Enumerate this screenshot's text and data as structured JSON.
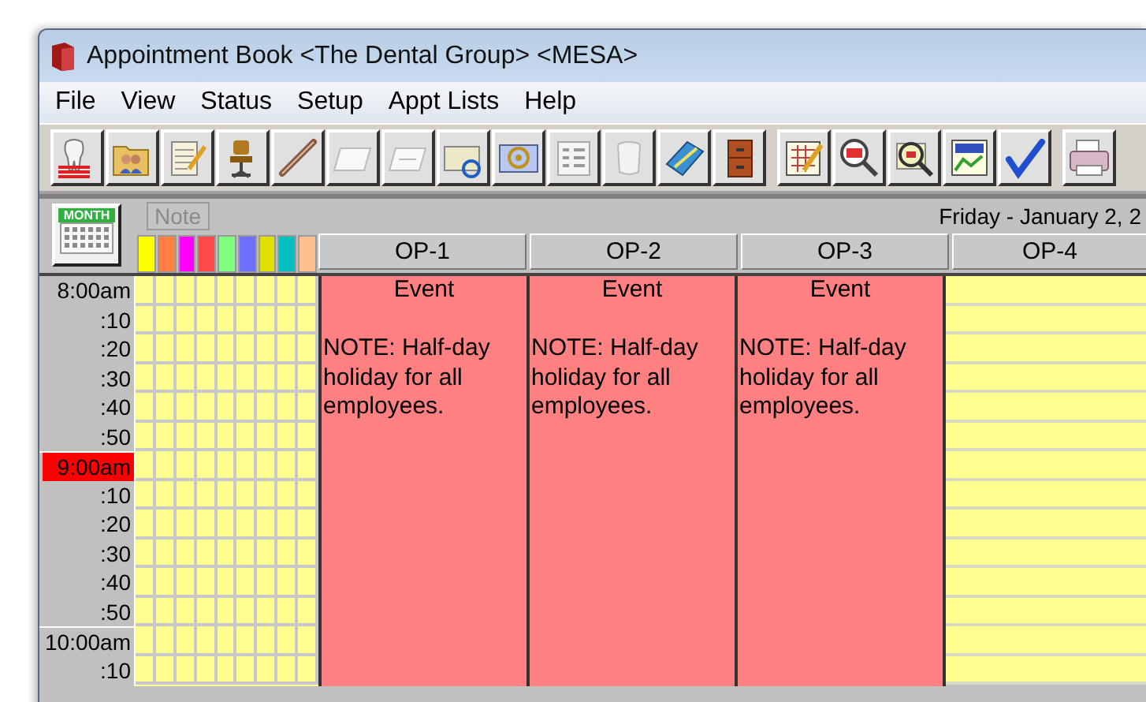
{
  "window": {
    "title": "Appointment Book <The Dental Group> <MESA>"
  },
  "menu": [
    "File",
    "View",
    "Status",
    "Setup",
    "Appt Lists",
    "Help"
  ],
  "header": {
    "month_button": "MONTH",
    "note_button": "Note",
    "date": "Friday - January 2, 2"
  },
  "color_columns": [
    {
      "color": "#ffff00"
    },
    {
      "color": "#ff8040"
    },
    {
      "color": "#ff00ff"
    },
    {
      "color": "#ff4848"
    },
    {
      "color": "#80ff80"
    },
    {
      "color": "#7070ff"
    },
    {
      "color": "#e0e000"
    },
    {
      "color": "#00c0c0"
    },
    {
      "color": "#ffc090"
    }
  ],
  "operatories": [
    {
      "name": "OP-1",
      "event": {
        "title": "Event",
        "note": "NOTE: Half-day holiday for all employees."
      }
    },
    {
      "name": "OP-2",
      "event": {
        "title": "Event",
        "note": "NOTE: Half-day holiday for all employees."
      }
    },
    {
      "name": "OP-3",
      "event": {
        "title": "Event",
        "note": "NOTE: Half-day holiday for all employees."
      }
    },
    {
      "name": "OP-4"
    }
  ],
  "time_slots": [
    {
      "label": "8:00am",
      "kind": "hour",
      "current": false
    },
    {
      "label": ":10",
      "kind": "minute",
      "current": false
    },
    {
      "label": ":20",
      "kind": "minute",
      "current": false
    },
    {
      "label": ":30",
      "kind": "minute",
      "current": false
    },
    {
      "label": ":40",
      "kind": "minute",
      "current": false
    },
    {
      "label": ":50",
      "kind": "minute",
      "current": false
    },
    {
      "label": "9:00am",
      "kind": "hour",
      "current": true
    },
    {
      "label": ":10",
      "kind": "minute",
      "current": false
    },
    {
      "label": ":20",
      "kind": "minute",
      "current": false
    },
    {
      "label": ":30",
      "kind": "minute",
      "current": false
    },
    {
      "label": ":40",
      "kind": "minute",
      "current": false
    },
    {
      "label": ":50",
      "kind": "minute",
      "current": false
    },
    {
      "label": "10:00am",
      "kind": "hour",
      "current": false
    },
    {
      "label": ":10",
      "kind": "minute",
      "current": false
    }
  ]
}
